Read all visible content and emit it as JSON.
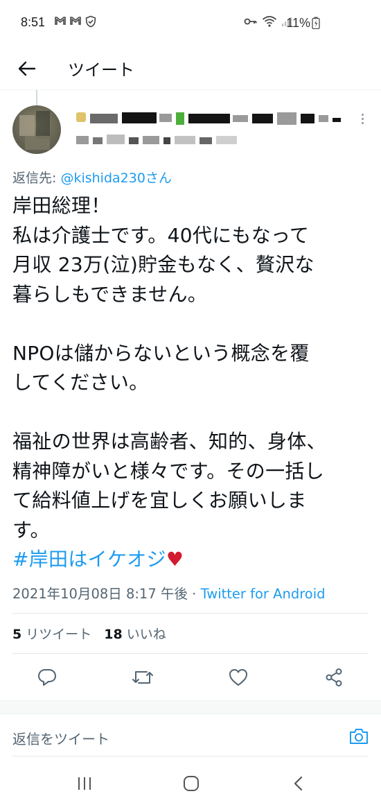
{
  "status_bar": {
    "time": "8:51",
    "battery": "11%",
    "left_icons": [
      "gmail-icon",
      "gmail-icon",
      "shield-icon"
    ],
    "right_icons": [
      "key-icon",
      "wifi-icon",
      "signal-icon",
      "battery-icon"
    ]
  },
  "header": {
    "title": "ツイート",
    "back_icon": "arrow-left-icon"
  },
  "tweet": {
    "reply_prefix": "返信先: ",
    "reply_mention": "@kishida230さん",
    "body": "岸田総理！\n私は介護士です。40代にもなって\n月収 23万(泣)貯金もなく、贅沢な\n暮らしもできません。\n\nNPOは儲からないという概念を覆\nしてください。\n\n福祉の世界は高齢者、知的、身体、\n精神障がいと様々です。その一括し\nて給料値上げを宜しくお願いしま\nす。",
    "hashtag": "#岸田はイケオジ",
    "emoji": "♥",
    "timestamp": "2021年10月08日 8:17 午後",
    "separator": " · ",
    "source": "Twitter for Android"
  },
  "stats": {
    "retweets_count": "5",
    "retweets_label": "リツイート",
    "likes_count": "18",
    "likes_label": "いいね"
  },
  "actions": [
    "reply-icon",
    "retweet-icon",
    "like-icon",
    "share-icon"
  ],
  "reply_bar": {
    "placeholder": "返信をツイート",
    "camera_icon": "camera-icon"
  },
  "nav_bar": [
    "recent-apps-icon",
    "home-icon",
    "back-icon"
  ],
  "colors": {
    "accent": "#1d9bf0",
    "text": "#0f1419",
    "secondary": "#536471",
    "heart": "#d21b30"
  }
}
